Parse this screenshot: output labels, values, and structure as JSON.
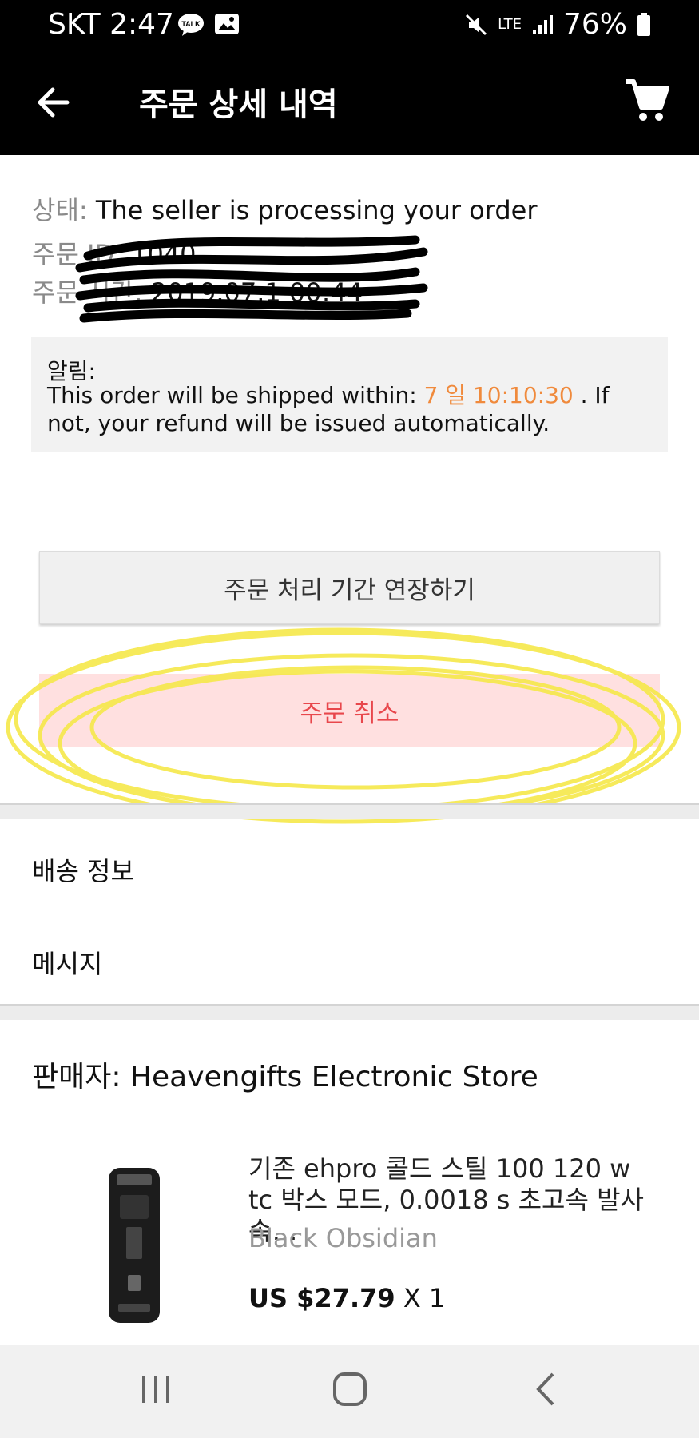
{
  "status_bar": {
    "carrier_time": "SKT 2:47",
    "talk_badge": "TALK",
    "network": "LTE",
    "battery": "76%"
  },
  "appbar": {
    "title": "주문 상세 내역",
    "back_icon": "arrow-left-icon",
    "cart_icon": "cart-icon"
  },
  "order": {
    "status_label": "상태:",
    "status_value": "The seller is processing your order",
    "id_label": "주문 ID:",
    "id_value": "1040",
    "time_label": "주문 시간:",
    "time_value": "2019.07.1  00:44"
  },
  "notice": {
    "title": "알림:",
    "text_before": "This order will be shipped within:",
    "countdown": "7 일 10:10:30",
    "text_after": ". If not, your refund will be issued automatically."
  },
  "buttons": {
    "extend": "주문 처리 기간 연장하기",
    "cancel": "주문 취소"
  },
  "links": {
    "shipping": "배송 정보",
    "message": "메시지"
  },
  "seller": {
    "label": "판매자: Heavengifts Electronic Store"
  },
  "product": {
    "name": "기존 ehpro 콜드 스틸 100 120 w tc 박스 모드, 0.0018 s 초고속 발사 속…",
    "variant": "Black Obsidian",
    "price": "US $27.79",
    "qty": "X 1"
  },
  "colors": {
    "accent_orange": "#f08a3c",
    "cancel_text": "#e8474c",
    "cancel_bg": "#ffe0e0",
    "highlight_yellow": "#f6e84a"
  }
}
